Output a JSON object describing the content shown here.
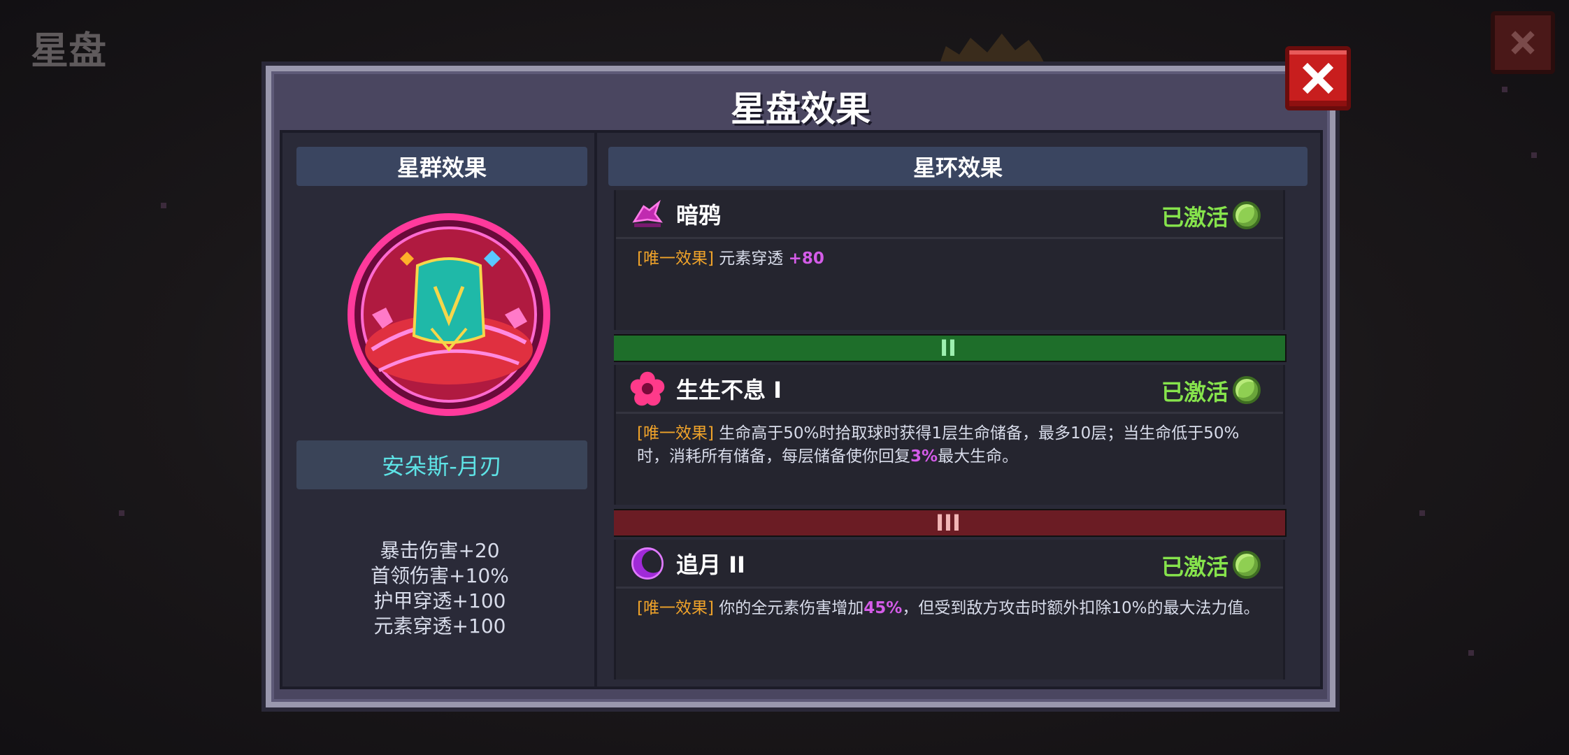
{
  "background": {
    "title": "星盘"
  },
  "dialog": {
    "title": "星盘效果"
  },
  "left": {
    "header": "星群效果",
    "character_name": "安朵斯-月刃",
    "stats": [
      "暴击伤害+20",
      "首领伤害+10%",
      "护甲穿透+100",
      "元素穿透+100"
    ]
  },
  "right": {
    "header": "星环效果",
    "entries": [
      {
        "name": "暗鸦",
        "status": "已激活",
        "tag": "[唯一效果]",
        "desc_a": "元素穿透 ",
        "highlight": "+80",
        "desc_b": ""
      },
      {
        "name": "生生不息 I",
        "status": "已激活",
        "tag": "[唯一效果]",
        "desc_a": "生命高于50%时拾取球时获得1层生命储备，最多10层；当生命低于50%时，消耗所有储备，每层储备使你回复",
        "highlight": "3%",
        "desc_b": "最大生命。"
      },
      {
        "name": "追月 II",
        "status": "已激活",
        "tag": "[唯一效果]",
        "desc_a": "你的全元素伤害增加",
        "highlight": "45%",
        "desc_b": "，但受到敌方攻击时额外扣除10%的最大法力值。"
      }
    ],
    "dividers": [
      "II",
      "III"
    ]
  },
  "colors": {
    "active_green": "#86e34c",
    "tag_orange": "#f0a32a",
    "highlight_purple": "#d45ce8",
    "character_cyan": "#5ee3e6"
  }
}
